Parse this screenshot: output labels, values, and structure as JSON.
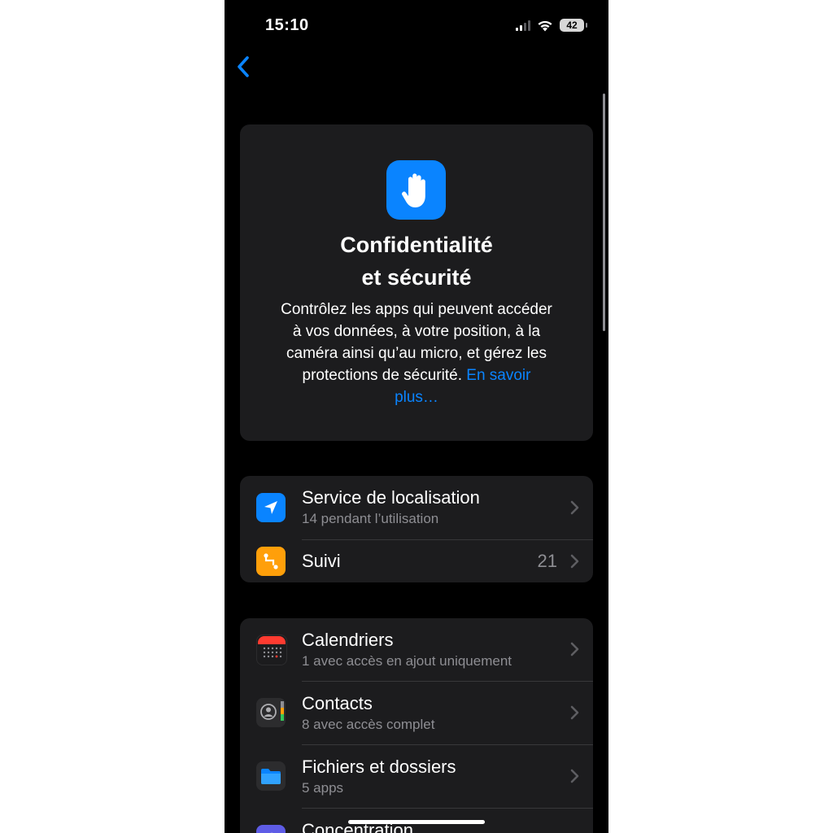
{
  "status_bar": {
    "time": "15:10",
    "battery": "42"
  },
  "header": {
    "title_line1": "Confidentialité",
    "title_line2": "et sécurité",
    "description": "Contrôlez les apps qui peuvent accéder à vos données, à votre position, à la caméra ainsi qu’au micro, et gérez les protections de sécurité.",
    "learn_more": "En savoir plus…",
    "icon": "hand-raised-icon"
  },
  "group1": {
    "items": [
      {
        "title": "Service de localisation",
        "subtitle": "14 pendant l’utilisation",
        "icon": "location-arrow-icon",
        "color": "#0a84ff"
      },
      {
        "title": "Suivi",
        "value": "21",
        "icon": "tracking-icon",
        "color": "#ff9f0a"
      }
    ]
  },
  "group2": {
    "items": [
      {
        "title": "Calendriers",
        "subtitle": "1 avec accès en ajout uniquement",
        "icon": "calendar-icon"
      },
      {
        "title": "Contacts",
        "subtitle": "8 avec accès complet",
        "icon": "contacts-icon"
      },
      {
        "title": "Fichiers et dossiers",
        "subtitle": "5 apps",
        "icon": "folder-icon"
      },
      {
        "title": "Concentration",
        "icon": "moon-icon"
      }
    ]
  },
  "colors": {
    "accent": "#0a84ff",
    "background": "#000000",
    "card": "#1c1c1e"
  }
}
